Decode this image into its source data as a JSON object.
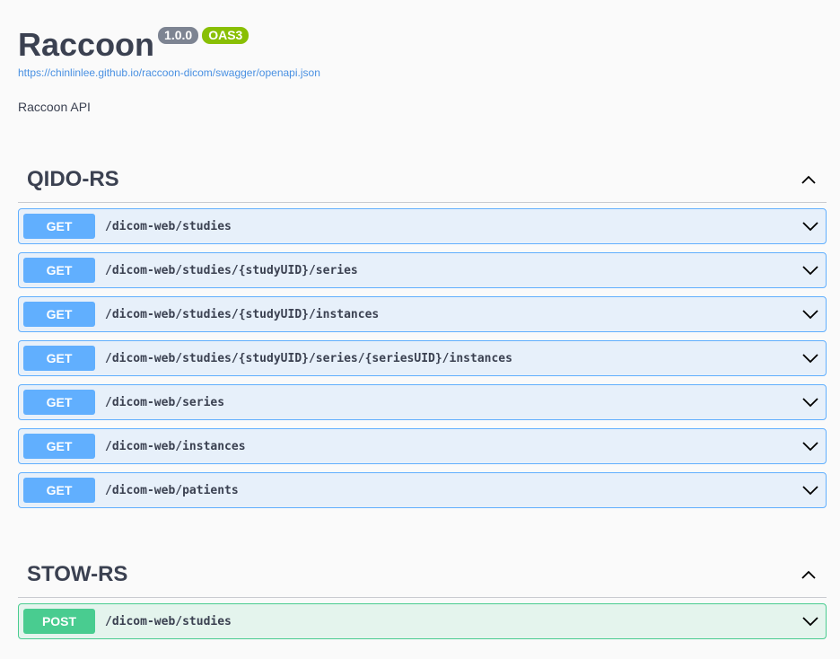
{
  "info": {
    "title": "Raccoon",
    "version": "1.0.0",
    "oas_badge": "OAS3",
    "spec_url": "https://chinlinlee.github.io/raccoon-dicom/swagger/openapi.json",
    "description": "Raccoon API"
  },
  "colors": {
    "get": "#61affe",
    "post": "#49cc90",
    "version_badge": "#7d8492",
    "oas_badge": "#89bf04",
    "link": "#4990e2"
  },
  "tags": [
    {
      "name": "QIDO-RS",
      "expanded": true,
      "toggle_icon": "chevron-up-icon",
      "operations": [
        {
          "method": "GET",
          "path": "/dicom-web/studies"
        },
        {
          "method": "GET",
          "path": "/dicom-web/studies/{studyUID}/series"
        },
        {
          "method": "GET",
          "path": "/dicom-web/studies/{studyUID}/instances"
        },
        {
          "method": "GET",
          "path": "/dicom-web/studies/{studyUID}/series/{seriesUID}/instances"
        },
        {
          "method": "GET",
          "path": "/dicom-web/series"
        },
        {
          "method": "GET",
          "path": "/dicom-web/instances"
        },
        {
          "method": "GET",
          "path": "/dicom-web/patients"
        }
      ]
    },
    {
      "name": "STOW-RS",
      "expanded": true,
      "toggle_icon": "chevron-up-icon",
      "operations": [
        {
          "method": "POST",
          "path": "/dicom-web/studies"
        }
      ]
    }
  ]
}
